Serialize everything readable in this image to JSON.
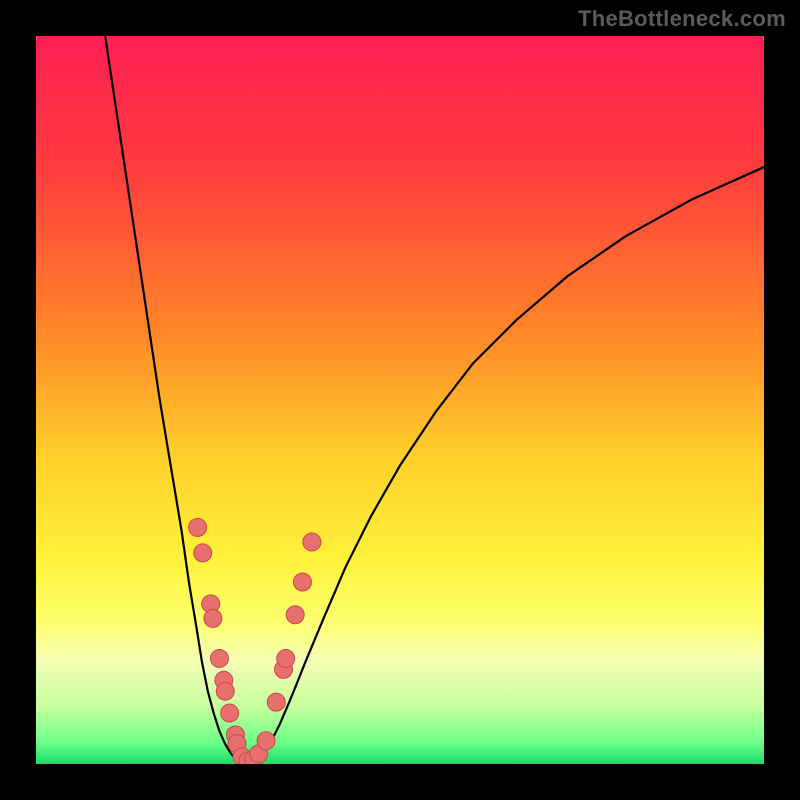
{
  "watermark": "TheBottleneck.com",
  "colors": {
    "frame": "#000000",
    "gradient_stops": [
      {
        "offset": 0.0,
        "color": "#ff1f55"
      },
      {
        "offset": 0.18,
        "color": "#ff3b3e"
      },
      {
        "offset": 0.4,
        "color": "#ff8429"
      },
      {
        "offset": 0.58,
        "color": "#ffd02a"
      },
      {
        "offset": 0.72,
        "color": "#fff23b"
      },
      {
        "offset": 0.8,
        "color": "#ffff6b"
      },
      {
        "offset": 0.86,
        "color": "#f4ffb5"
      },
      {
        "offset": 0.92,
        "color": "#c8ff9e"
      },
      {
        "offset": 0.97,
        "color": "#6dff87"
      },
      {
        "offset": 1.0,
        "color": "#19de6a"
      }
    ],
    "curve": "#000000",
    "markers_fill": "#e76f6e",
    "markers_stroke": "#c94948"
  },
  "chart_data": {
    "type": "line",
    "title": "",
    "xlabel": "",
    "ylabel": "",
    "xlim": [
      0,
      100
    ],
    "ylim": [
      0,
      100
    ],
    "series": [
      {
        "name": "left-branch",
        "x": [
          9.5,
          11,
          12.5,
          14,
          15.5,
          17,
          18.5,
          20,
          21,
          22,
          22.8,
          23.6,
          24.4,
          25.2,
          26.0,
          26.8,
          27.5
        ],
        "y": [
          100,
          90,
          80,
          70,
          60,
          50,
          41,
          32,
          25,
          19,
          14,
          10,
          7,
          4.5,
          2.7,
          1.4,
          0.6
        ]
      },
      {
        "name": "valley",
        "x": [
          27.5,
          28.3,
          29.1,
          29.9,
          30.7
        ],
        "y": [
          0.6,
          0.15,
          0.05,
          0.15,
          0.6
        ]
      },
      {
        "name": "right-branch",
        "x": [
          30.7,
          32,
          33.5,
          35,
          37,
          39.5,
          42.5,
          46,
          50,
          55,
          60,
          66,
          73,
          81,
          90,
          100
        ],
        "y": [
          0.6,
          2.5,
          5.5,
          9,
          14,
          20,
          27,
          34,
          41,
          48.5,
          55,
          61,
          67,
          72.5,
          77.5,
          82
        ]
      }
    ],
    "markers": {
      "name": "highlighted-points",
      "points": [
        {
          "x": 22.2,
          "y": 32.5
        },
        {
          "x": 22.9,
          "y": 29.0
        },
        {
          "x": 24.0,
          "y": 22.0
        },
        {
          "x": 24.3,
          "y": 20.0
        },
        {
          "x": 25.2,
          "y": 14.5
        },
        {
          "x": 25.8,
          "y": 11.5
        },
        {
          "x": 26.0,
          "y": 10.0
        },
        {
          "x": 26.6,
          "y": 7.0
        },
        {
          "x": 27.4,
          "y": 4.0
        },
        {
          "x": 27.6,
          "y": 2.8
        },
        {
          "x": 28.3,
          "y": 1.0
        },
        {
          "x": 29.1,
          "y": 0.4
        },
        {
          "x": 29.9,
          "y": 0.6
        },
        {
          "x": 30.6,
          "y": 1.4
        },
        {
          "x": 31.6,
          "y": 3.2
        },
        {
          "x": 33.0,
          "y": 8.5
        },
        {
          "x": 34.0,
          "y": 13.0
        },
        {
          "x": 34.3,
          "y": 14.5
        },
        {
          "x": 35.6,
          "y": 20.5
        },
        {
          "x": 36.6,
          "y": 25.0
        },
        {
          "x": 37.9,
          "y": 30.5
        }
      ],
      "radius": 9
    }
  }
}
